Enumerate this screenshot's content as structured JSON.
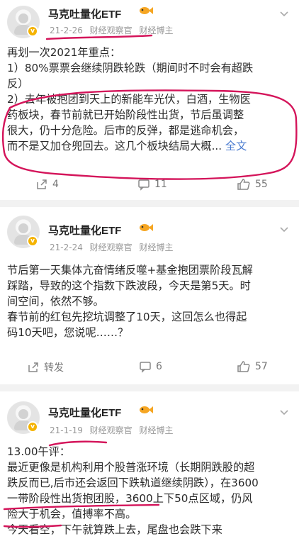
{
  "posts": [
    {
      "author": "马克吐量化ETF",
      "date": "21-2-26",
      "tags": [
        "财经观察官",
        "财经博主"
      ],
      "lines": [
        "再划一次2021年重点：",
        "1）80%票票会继续阴跌轮跌（期间时不时会有超跌",
        "反）",
        "2）去年被抱团到天上的新能车光伏，白酒，生物医",
        "药板块，春节前就已开始阶段性出货，节后虽调整",
        "很大，仍十分危险。后市的反弹，都是逃命机会，",
        "而不是又加仓兜回去。这几个板块结局大概..."
      ],
      "full_text_label": "全文",
      "repost": "4",
      "comments": "11",
      "likes": "55"
    },
    {
      "author": "马克吐量化ETF",
      "date": "21-2-24",
      "tags": [
        "财经观察官",
        "财经博主"
      ],
      "lines": [
        "节后第一天集体亢奋情绪反噬+基金抱团票阶段瓦解",
        "踩踏，导致的这个指数下跌波段，今天是第5天。时",
        "间空间，依然不够。",
        "春节前的红包先挖坑调整了10天，这回怎么也得起",
        "码10天吧，您说呢……？"
      ],
      "repost": "转发",
      "comments": "6",
      "likes": "57"
    },
    {
      "author": "马克吐量化ETF",
      "date": "21-1-19",
      "tags": [
        "财经观察官",
        "财经博主"
      ],
      "lines": [
        "13.00午评：",
        "最近更像是机构利用个股普涨环境（长期阴跌股的超",
        "跌反而已,后市还会返回下跌轨道继续阴跌），在3600",
        "一带阶段性出货抱团股，3600上下50点区域，仍风",
        "险大于机会，值搏率不高。",
        "今天看空，下午就算跌上去，尾盘也会跌下来"
      ]
    }
  ],
  "colors": {
    "ink": "#d4145a",
    "link": "#4a7bd0",
    "badge": "#f5b301"
  }
}
